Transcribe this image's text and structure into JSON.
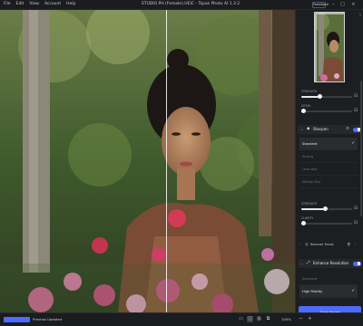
{
  "menu": [
    "File",
    "Edit",
    "View",
    "Account",
    "Help"
  ],
  "window_title": "STUDIO PH (Female).HEIC - Topaz Photo AI 1.3.2",
  "feedback_label": "Feedback",
  "window_controls": {
    "minimize": "–",
    "maximize": "□",
    "close": "×"
  },
  "panel": {
    "top_sliders": [
      {
        "label": "Strength",
        "value": ""
      },
      {
        "label": "Detail",
        "value": ""
      }
    ],
    "sharpen": {
      "title": "Sharpen",
      "enabled": true,
      "models": [
        {
          "label": "Standard",
          "active": true
        },
        {
          "label": "Strong",
          "active": false
        },
        {
          "label": "Lens Blur",
          "active": false
        },
        {
          "label": "Motion Blur",
          "active": false
        }
      ],
      "sliders": [
        {
          "label": "Strength",
          "value": ""
        },
        {
          "label": "Clarity",
          "value": ""
        }
      ]
    },
    "recover_faces": {
      "label": "Recover Faces"
    },
    "enhance_resolution": {
      "title": "Enhance Resolution",
      "enabled": true,
      "models": [
        {
          "label": "Standard",
          "active": false
        },
        {
          "label": "High Fidelity",
          "active": true
        }
      ]
    },
    "save_label": "Save Image"
  },
  "status": {
    "text": "Preview Updated",
    "zoom": "100%"
  },
  "colors": {
    "accent": "#4d6cff",
    "panel_bg": "#1d1e21",
    "bar_bg": "#1b1c1f"
  }
}
